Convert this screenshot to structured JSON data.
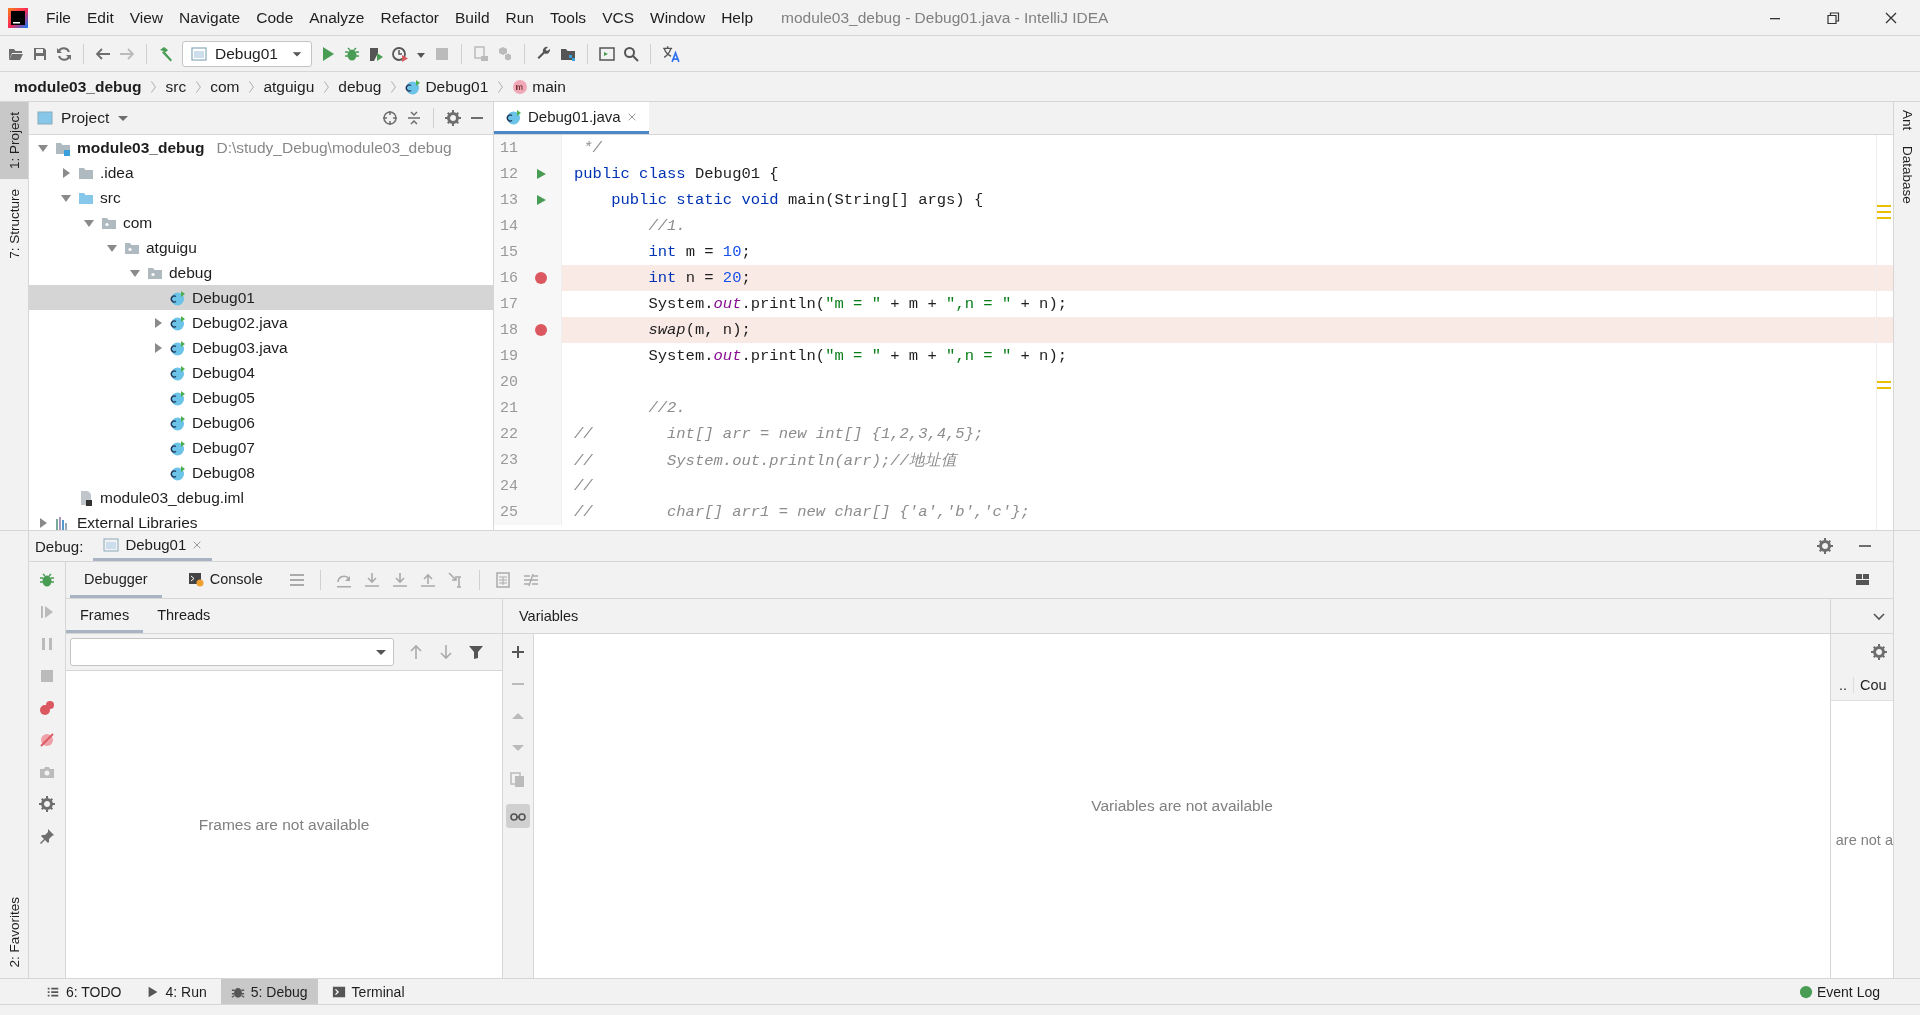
{
  "window": {
    "title": "module03_debug - Debug01.java - IntelliJ IDEA"
  },
  "menu": [
    "File",
    "Edit",
    "View",
    "Navigate",
    "Code",
    "Analyze",
    "Refactor",
    "Build",
    "Run",
    "Tools",
    "VCS",
    "Window",
    "Help"
  ],
  "toolbar": {
    "run_config": "Debug01"
  },
  "breadcrumbs": [
    {
      "label": "module03_debug",
      "kind": "module"
    },
    {
      "label": "src",
      "kind": "folder"
    },
    {
      "label": "com",
      "kind": "folder"
    },
    {
      "label": "atguigu",
      "kind": "folder"
    },
    {
      "label": "debug",
      "kind": "folder"
    },
    {
      "label": "Debug01",
      "kind": "class"
    },
    {
      "label": "main",
      "kind": "method"
    }
  ],
  "left_strip": [
    {
      "label": "1: Project",
      "selected": true
    },
    {
      "label": "7: Structure",
      "selected": false
    }
  ],
  "left_strip_bottom": [
    {
      "label": "2: Favorites",
      "selected": false
    }
  ],
  "right_strip": [
    {
      "label": "Ant"
    },
    {
      "label": "Database"
    }
  ],
  "project": {
    "title": "Project",
    "tree": [
      {
        "label": "module03_debug",
        "path": "D:\\study_Debug\\module03_debug",
        "kind": "module",
        "expanded": true,
        "selected": false,
        "children": [
          {
            "label": ".idea",
            "kind": "folder",
            "expanded": false,
            "selected": false
          },
          {
            "label": "src",
            "kind": "source",
            "expanded": true,
            "selected": false,
            "children": [
              {
                "label": "com",
                "kind": "package",
                "expanded": true,
                "selected": false,
                "children": [
                  {
                    "label": "atguigu",
                    "kind": "package",
                    "expanded": true,
                    "selected": false,
                    "children": [
                      {
                        "label": "debug",
                        "kind": "package",
                        "expanded": true,
                        "selected": false,
                        "children": [
                          {
                            "label": "Debug01",
                            "kind": "class",
                            "selected": true
                          },
                          {
                            "label": "Debug02.java",
                            "kind": "class",
                            "expanded": false,
                            "selected": false
                          },
                          {
                            "label": "Debug03.java",
                            "kind": "class",
                            "expanded": false,
                            "selected": false
                          },
                          {
                            "label": "Debug04",
                            "kind": "class",
                            "selected": false
                          },
                          {
                            "label": "Debug05",
                            "kind": "class",
                            "selected": false
                          },
                          {
                            "label": "Debug06",
                            "kind": "class",
                            "selected": false
                          },
                          {
                            "label": "Debug07",
                            "kind": "class",
                            "selected": false
                          },
                          {
                            "label": "Debug08",
                            "kind": "class",
                            "selected": false
                          }
                        ]
                      }
                    ]
                  }
                ]
              }
            ]
          },
          {
            "label": "module03_debug.iml",
            "kind": "file",
            "selected": false
          }
        ]
      },
      {
        "label": "External Libraries",
        "kind": "library",
        "expanded": false,
        "selected": false
      }
    ]
  },
  "editor": {
    "tabs": [
      {
        "label": "Debug01.java",
        "selected": true
      }
    ],
    "lines": [
      {
        "number": "11",
        "breakpoint": false,
        "tokens": [
          {
            "kind": "comment",
            "text": " */"
          }
        ]
      },
      {
        "number": "12",
        "breakpoint": false,
        "runnable": true,
        "tokens": [
          {
            "kind": "keyword",
            "text": "public class "
          },
          {
            "kind": "plain",
            "text": "Debug01 {"
          }
        ]
      },
      {
        "number": "13",
        "breakpoint": false,
        "runnable": true,
        "tokens": [
          {
            "kind": "keyword",
            "text": "    public static void "
          },
          {
            "kind": "plain",
            "text": "main(String[] args) {"
          }
        ]
      },
      {
        "number": "14",
        "breakpoint": false,
        "tokens": [
          {
            "kind": "comment",
            "text": "        //1."
          }
        ]
      },
      {
        "number": "15",
        "breakpoint": false,
        "tokens": [
          {
            "kind": "keyword",
            "text": "        int "
          },
          {
            "kind": "plain",
            "text": "m = "
          },
          {
            "kind": "number",
            "text": "10"
          },
          {
            "kind": "plain",
            "text": ";"
          }
        ]
      },
      {
        "number": "16",
        "breakpoint": true,
        "tokens": [
          {
            "kind": "keyword",
            "text": "        int "
          },
          {
            "kind": "plain",
            "text": "n = "
          },
          {
            "kind": "number",
            "text": "20"
          },
          {
            "kind": "plain",
            "text": ";"
          }
        ]
      },
      {
        "number": "17",
        "breakpoint": false,
        "tokens": [
          {
            "kind": "plain",
            "text": "        System."
          },
          {
            "kind": "field",
            "text": "out"
          },
          {
            "kind": "plain",
            "text": ".println("
          },
          {
            "kind": "string",
            "text": "\"m = \""
          },
          {
            "kind": "plain",
            "text": " + m + "
          },
          {
            "kind": "string",
            "text": "\",n = \""
          },
          {
            "kind": "plain",
            "text": " + n);"
          }
        ]
      },
      {
        "number": "18",
        "breakpoint": true,
        "tokens": [
          {
            "kind": "method",
            "text": "        swap"
          },
          {
            "kind": "plain",
            "text": "(m, n);"
          }
        ]
      },
      {
        "number": "19",
        "breakpoint": false,
        "tokens": [
          {
            "kind": "plain",
            "text": "        System."
          },
          {
            "kind": "field",
            "text": "out"
          },
          {
            "kind": "plain",
            "text": ".println("
          },
          {
            "kind": "string",
            "text": "\"m = \""
          },
          {
            "kind": "plain",
            "text": " + m + "
          },
          {
            "kind": "string",
            "text": "\",n = \""
          },
          {
            "kind": "plain",
            "text": " + n);"
          }
        ]
      },
      {
        "number": "20",
        "breakpoint": false
      },
      {
        "number": "21",
        "breakpoint": false,
        "tokens": [
          {
            "kind": "comment",
            "text": "        //2."
          }
        ]
      },
      {
        "number": "22",
        "breakpoint": false,
        "tokens": [
          {
            "kind": "comment",
            "text": "//        int[] arr = new int[] {1,2,3,4,5};"
          }
        ]
      },
      {
        "number": "23",
        "breakpoint": false,
        "tokens": [
          {
            "kind": "comment",
            "text": "//        System.out.println(arr);//地址值"
          }
        ]
      },
      {
        "number": "24",
        "breakpoint": false,
        "tokens": [
          {
            "kind": "comment",
            "text": "//"
          }
        ]
      },
      {
        "number": "25",
        "breakpoint": false,
        "tokens": [
          {
            "kind": "comment",
            "text": "//        char[] arr1 = new char[] {'a','b','c'};"
          }
        ]
      }
    ]
  },
  "debug": {
    "label": "Debug:",
    "session_tabs": [
      {
        "label": "Debug01",
        "selected": true
      }
    ],
    "tabs": [
      {
        "label": "Debugger",
        "selected": true
      },
      {
        "label": "Console",
        "selected": false
      }
    ],
    "frames": {
      "tabs": [
        {
          "label": "Frames",
          "selected": true
        },
        {
          "label": "Threads",
          "selected": false
        }
      ],
      "empty_text": "Frames are not available"
    },
    "variables": {
      "title": "Variables",
      "empty_text": "Variables are not available"
    },
    "memory": {
      "column_1": "..",
      "column_2": "Cou",
      "empty_text": "are not a"
    }
  },
  "tool_tabs": [
    {
      "label": "6: TODO",
      "kind": "list",
      "selected": false
    },
    {
      "label": "4: Run",
      "kind": "run",
      "selected": false
    },
    {
      "label": "5: Debug",
      "kind": "debug",
      "selected": true
    },
    {
      "label": "Terminal",
      "kind": "terminal",
      "selected": false
    }
  ],
  "event_log": "Event Log"
}
